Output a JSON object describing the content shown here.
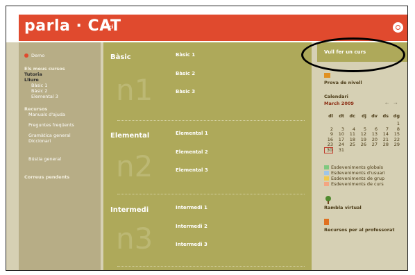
{
  "header": {
    "logo": "parla",
    "logo_sep": "·",
    "logo_tail": "CAT",
    "nav_home": "Inici"
  },
  "sidebar": {
    "demo": "Demo",
    "my_courses_title": "Els meus cursos",
    "tutoring": "Tutoria",
    "free": "Lliure",
    "courses": [
      "Bàsic 1",
      "Bàsic 2",
      "Elemental 3"
    ],
    "resources_title": "Recursos",
    "help_manuals": "Manuals d'ajuda",
    "faq": "Preguntes freqüents",
    "grammar": "Gramàtica general",
    "dictionary": "Diccionari",
    "mailbox": "Bústia general",
    "pending_mail": "Correus pendents"
  },
  "main": {
    "levels": [
      {
        "name": "Bàsic",
        "badge": "n1",
        "courses": [
          "Bàsic 1",
          "Bàsic 2",
          "Bàsic 3"
        ]
      },
      {
        "name": "Elemental",
        "badge": "n2",
        "courses": [
          "Elemental 1",
          "Elemental 2",
          "Elemental 3"
        ]
      },
      {
        "name": "Intermedi",
        "badge": "n3",
        "courses": [
          "Intermedi 1",
          "Intermedi 2",
          "Intermedi 3"
        ]
      }
    ]
  },
  "right": {
    "want_course": "Vull fer un curs",
    "level_test": "Prova de nivell",
    "calendar_title": "Calendari",
    "month": "March 2009",
    "prev": "←",
    "next": "→",
    "weekdays": [
      "dl",
      "dt",
      "dc",
      "dj",
      "dv",
      "ds",
      "dg"
    ],
    "weeks": [
      [
        "",
        "",
        "",
        "",
        "",
        "",
        "1"
      ],
      [
        "2",
        "3",
        "4",
        "5",
        "6",
        "7",
        "8"
      ],
      [
        "9",
        "10",
        "11",
        "12",
        "13",
        "14",
        "15"
      ],
      [
        "16",
        "17",
        "18",
        "19",
        "20",
        "21",
        "22"
      ],
      [
        "23",
        "24",
        "25",
        "26",
        "27",
        "28",
        "29"
      ],
      [
        "30",
        "31",
        "",
        "",
        "",
        "",
        ""
      ]
    ],
    "today": "30",
    "legend": [
      {
        "label": "Esdeveniments globals",
        "color": "#7fc97f"
      },
      {
        "label": "Esdeveniments d'usuari",
        "color": "#9ec5e8"
      },
      {
        "label": "Esdeveniments de grup",
        "color": "#f2c94c"
      },
      {
        "label": "Esdeveniments de curs",
        "color": "#f4a582"
      }
    ],
    "rambla": "Rambla virtual",
    "teacher_resources": "Recursos per al professorat"
  },
  "colors": {
    "brand": "#e04a2e",
    "main_panel": "#aea95a",
    "sidebar": "#b7ad86"
  }
}
